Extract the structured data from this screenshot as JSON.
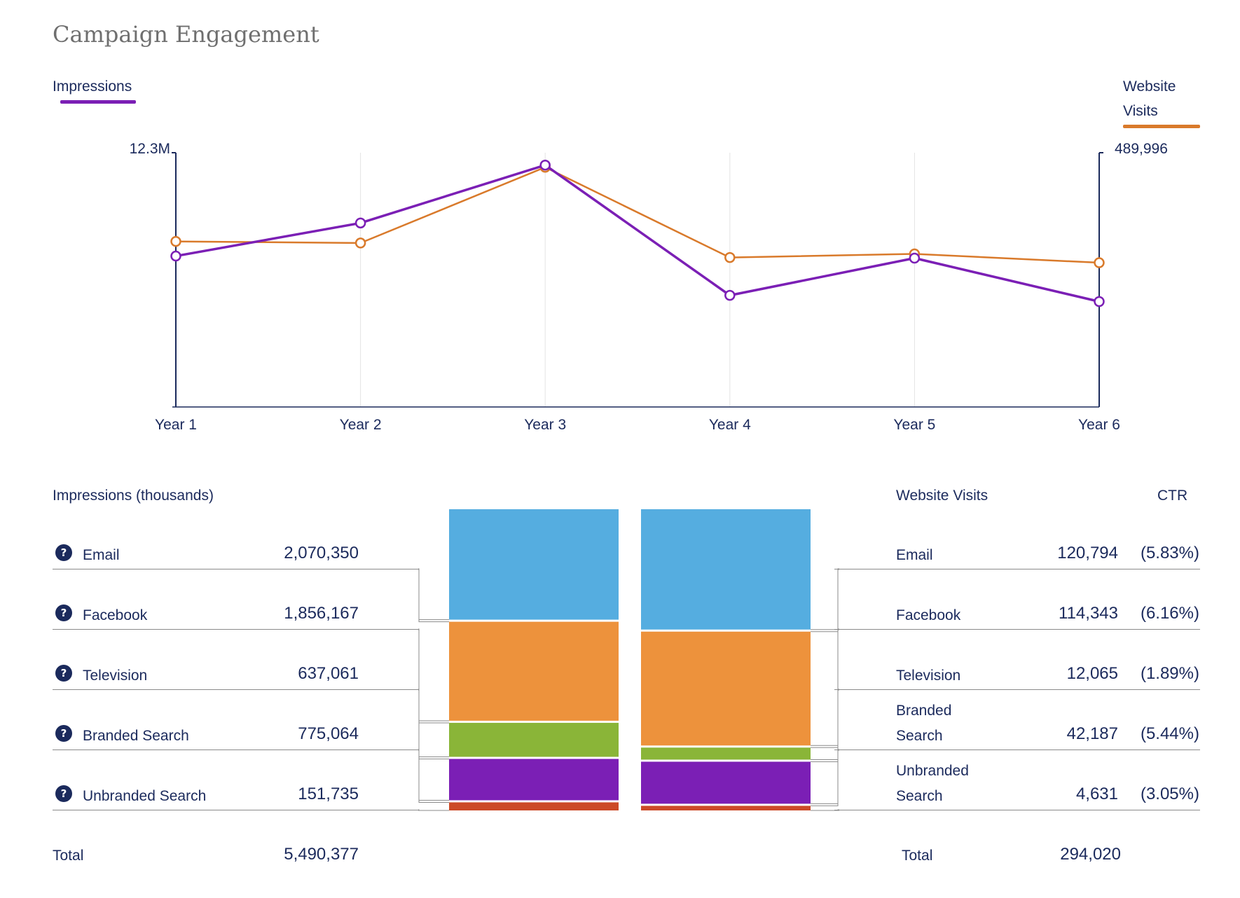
{
  "title": "Campaign Engagement",
  "legend": {
    "impressions": {
      "label": "Impressions",
      "color": "#7b1fb5"
    },
    "visits": {
      "label_line1": "Website",
      "label_line2": "Visits",
      "color": "#d97a2b"
    }
  },
  "chart_data": [
    {
      "type": "line",
      "x": [
        "Year 1",
        "Year 2",
        "Year 3",
        "Year 4",
        "Year 5",
        "Year 6"
      ],
      "y_left_max_label": "12.3M",
      "y_right_max_label": "489,996",
      "grid": "vertical",
      "series": [
        {
          "name": "Impressions",
          "axis": "left",
          "color": "#7b1fb5",
          "values": [
            7.3,
            8.9,
            11.7,
            5.4,
            7.2,
            5.1
          ]
        },
        {
          "name": "Website Visits",
          "axis": "right",
          "color": "#d97a2b",
          "values": [
            319000,
            316000,
            462000,
            288000,
            295000,
            278000
          ]
        }
      ]
    },
    {
      "type": "table",
      "headers": {
        "impressions": "Impressions (thousands)",
        "visits": "Website Visits",
        "ctr": "CTR"
      },
      "rows": [
        {
          "channel": "Email",
          "impressions": "2,070,350",
          "visits_label1": "Email",
          "visits_label2": "",
          "visits": "120,794",
          "ctr": "(5.83%)",
          "impressions_value": 2070350,
          "visits_value": 120794,
          "color": "#55ade0"
        },
        {
          "channel": "Facebook",
          "impressions": "1,856,167",
          "visits_label1": "Facebook",
          "visits_label2": "",
          "visits": "114,343",
          "ctr": "(6.16%)",
          "impressions_value": 1856167,
          "visits_value": 114343,
          "color": "#ed923c"
        },
        {
          "channel": "Television",
          "impressions": "637,061",
          "visits_label1": "Television",
          "visits_label2": "",
          "visits": "12,065",
          "ctr": "(1.89%)",
          "impressions_value": 637061,
          "visits_value": 12065,
          "color": "#8ab538"
        },
        {
          "channel": "Branded Search",
          "impressions": "775,064",
          "visits_label1": "Branded",
          "visits_label2": "Search",
          "visits": "42,187",
          "ctr": "(5.44%)",
          "impressions_value": 775064,
          "visits_value": 42187,
          "color": "#7b1fb5"
        },
        {
          "channel": "Unbranded Search",
          "impressions": "151,735",
          "visits_label1": "Unbranded",
          "visits_label2": "Search",
          "visits": "4,631",
          "ctr": "(3.05%)",
          "impressions_value": 151735,
          "visits_value": 4631,
          "color": "#cc4a28"
        }
      ],
      "total_label": "Total",
      "total_impressions": "5,490,377",
      "total_visits": "294,020"
    }
  ]
}
